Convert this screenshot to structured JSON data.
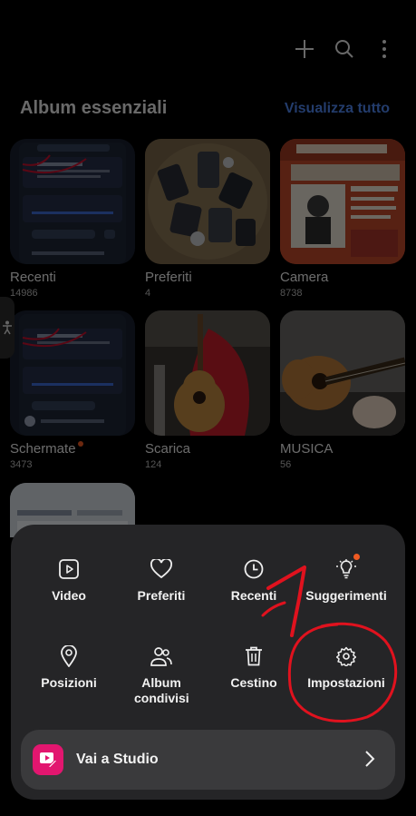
{
  "header": {
    "section_title": "Album essenziali",
    "view_all": "Visualizza tutto"
  },
  "albums": [
    {
      "name": "Recenti",
      "count": "14986"
    },
    {
      "name": "Preferiti",
      "count": "4"
    },
    {
      "name": "Camera",
      "count": "8738"
    },
    {
      "name": "Schermate",
      "count": "3473"
    },
    {
      "name": "Scarica",
      "count": "124"
    },
    {
      "name": "MUSICA",
      "count": "56"
    }
  ],
  "menu": {
    "items": [
      {
        "label": "Video",
        "icon": "play-icon"
      },
      {
        "label": "Preferiti",
        "icon": "heart-icon"
      },
      {
        "label": "Recenti",
        "icon": "clock-icon"
      },
      {
        "label": "Suggerimenti",
        "icon": "bulb-icon"
      },
      {
        "label": "Posizioni",
        "icon": "location-pin-icon"
      },
      {
        "label": "Album condivisi",
        "icon": "people-icon"
      },
      {
        "label": "Cestino",
        "icon": "trash-icon"
      },
      {
        "label": "Impostazioni",
        "icon": "gear-icon"
      }
    ],
    "studio_label": "Vai a Studio"
  },
  "annotation_number": "1",
  "colors": {
    "accent_blue": "#4f86f0",
    "badge_orange": "#f05a22",
    "studio_pink": "#e2166f",
    "annotation_red": "#e0121e"
  }
}
